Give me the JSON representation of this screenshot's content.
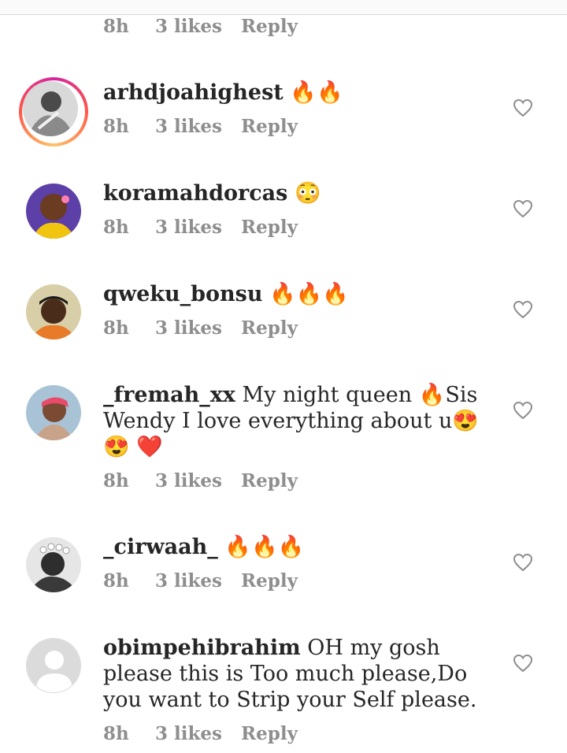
{
  "top_meta": {
    "time": "8h",
    "likes": "3 likes",
    "reply": "Reply"
  },
  "comments": [
    {
      "username": "arhdjoahighest",
      "text": " 🔥🔥",
      "time": "8h",
      "likes": "3 likes",
      "reply": "Reply"
    },
    {
      "username": "koramahdorcas",
      "text": " 😳",
      "time": "8h",
      "likes": "3 likes",
      "reply": "Reply"
    },
    {
      "username": "qweku_bonsu",
      "text": " 🔥🔥🔥",
      "time": "8h",
      "likes": "3 likes",
      "reply": "Reply"
    },
    {
      "username": "_fremah_xx",
      "text": " My night queen 🔥Sis Wendy I love everything about u😍😍 ❤️",
      "time": "8h",
      "likes": "3 likes",
      "reply": "Reply"
    },
    {
      "username": "_cirwaah_",
      "text": " 🔥🔥🔥",
      "time": "8h",
      "likes": "3 likes",
      "reply": "Reply"
    },
    {
      "username": "obimpehibrahim",
      "text": " OH my gosh please this is Too much please,Do you want to Strip your Self please.",
      "time": "8h",
      "likes": "3 likes",
      "reply": "Reply"
    }
  ],
  "icons": {
    "like": "heart-outline-icon"
  },
  "colors": {
    "meta": "#8e8e8e",
    "text": "#262626",
    "story_ring": "#d6249f"
  }
}
